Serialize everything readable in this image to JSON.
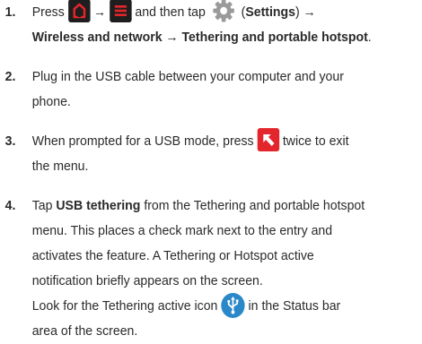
{
  "steps": [
    {
      "number": "1.",
      "t_press": "Press",
      "t_arrow_a": "→",
      "t_then": "and then tap",
      "t_open_paren": "(",
      "t_settings": "Settings",
      "t_close_arrow": ") →",
      "t_path": "Wireless and network → Tethering and portable hotspot",
      "t_period": "."
    },
    {
      "number": "2.",
      "line1": "Plug in the USB cable between your computer and your",
      "line2": "phone."
    },
    {
      "number": "3.",
      "t_before": "When prompted for a USB mode, press",
      "t_after": "twice to exit",
      "line2": "the menu."
    },
    {
      "number": "4.",
      "t_tap": "Tap",
      "t_usb": "USB tethering",
      "t_rest1": "from the Tethering and portable hotspot",
      "line2": "menu. This places a check mark next to the entry and",
      "line3": "activates the feature. A Tethering or Hotspot active",
      "line4": "notification briefly appears on the screen.",
      "t_look": "Look for the Tethering active icon",
      "t_status": "in the Status bar",
      "line6": "area of the screen."
    }
  ],
  "icons": {
    "home": "home-icon",
    "menu": "menu-icon",
    "settings": "settings-gear-icon",
    "back": "back-arrow-icon",
    "usb": "usb-tethering-icon",
    "key_color": "#1e1e1e",
    "accent_color": "#e3262c",
    "usb_color": "#2a88c8"
  }
}
